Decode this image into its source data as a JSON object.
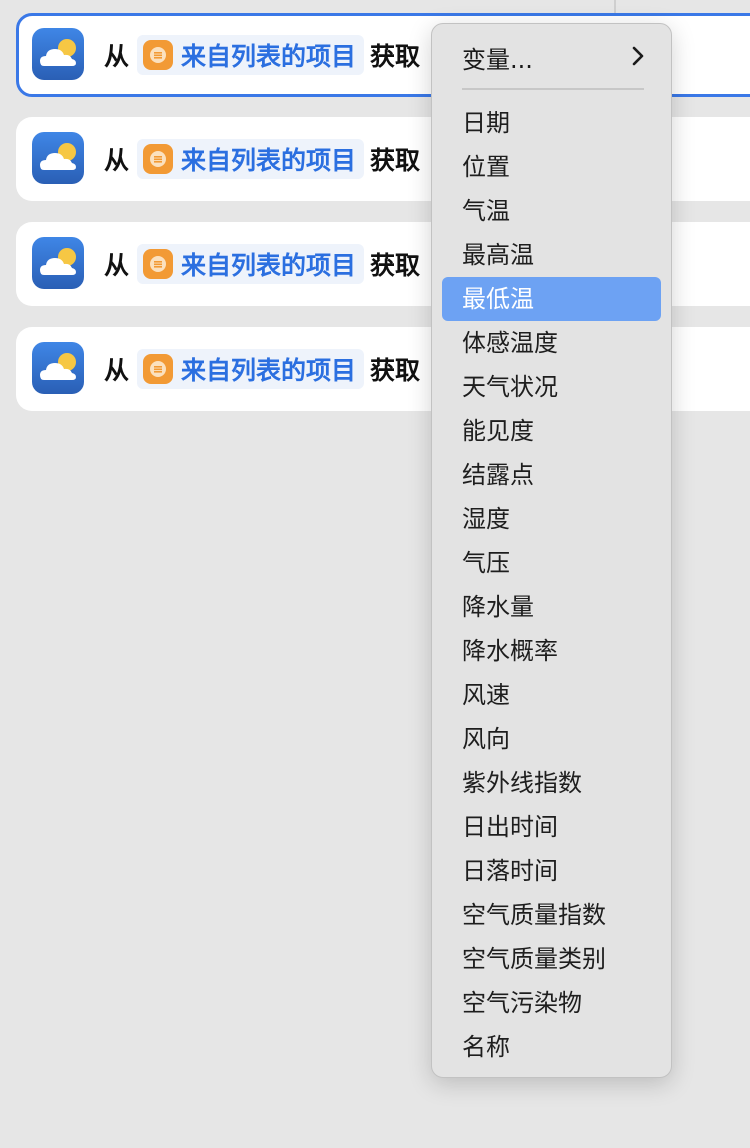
{
  "rows": [
    {
      "prefix": "从",
      "token_label": "来自列表的项目",
      "suffix": "获取"
    },
    {
      "prefix": "从",
      "token_label": "来自列表的项目",
      "suffix": "获取"
    },
    {
      "prefix": "从",
      "token_label": "来自列表的项目",
      "suffix": "获取"
    },
    {
      "prefix": "从",
      "token_label": "来自列表的项目",
      "suffix": "获取"
    }
  ],
  "icons": {
    "app_icon": "weather-icon",
    "token_icon": "list-icon",
    "submenu_icon": "chevron-right-icon"
  },
  "colors": {
    "accent": "#3a78e7",
    "token_text": "#2b6fe0",
    "token_icon_bg": "#f29a35",
    "menu_highlight": "#6da2f3"
  },
  "menu": {
    "header_label": "变量...",
    "selected_index": 4,
    "items": [
      "日期",
      "位置",
      "气温",
      "最高温",
      "最低温",
      "体感温度",
      "天气状况",
      "能见度",
      "结露点",
      "湿度",
      "气压",
      "降水量",
      "降水概率",
      "风速",
      "风向",
      "紫外线指数",
      "日出时间",
      "日落时间",
      "空气质量指数",
      "空气质量类别",
      "空气污染物",
      "名称"
    ]
  }
}
